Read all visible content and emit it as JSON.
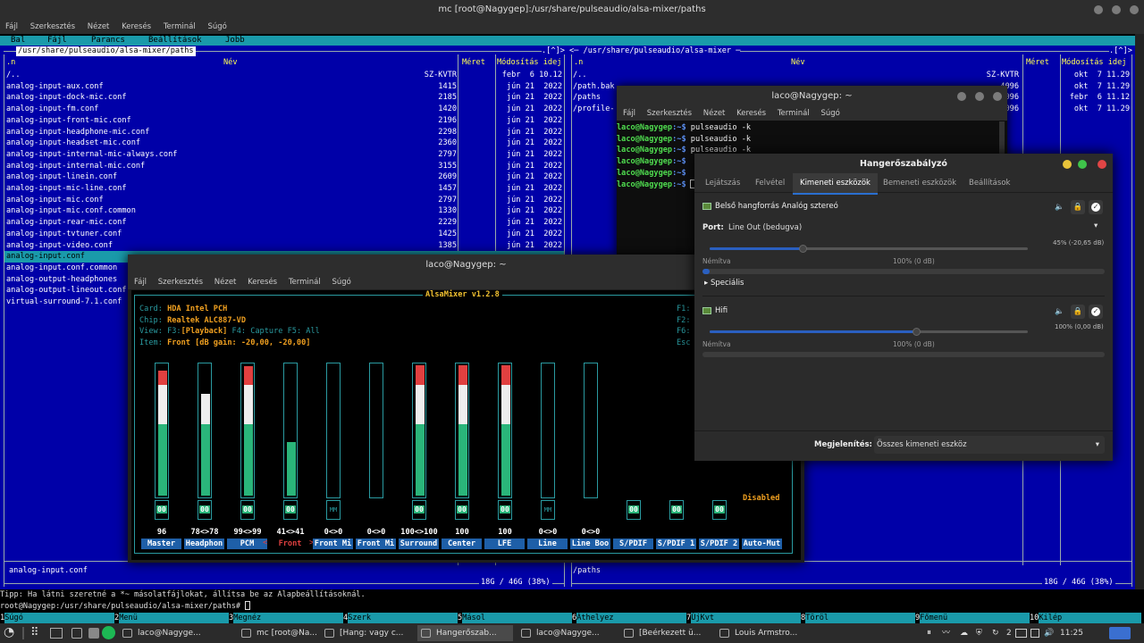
{
  "main_window": {
    "title": "mc [root@Nagygep]:/usr/share/pulseaudio/alsa-mixer/paths",
    "menu": [
      "Fájl",
      "Szerkesztés",
      "Nézet",
      "Keresés",
      "Terminál",
      "Súgó"
    ]
  },
  "mc": {
    "menubar": [
      "Bal",
      "Fájl",
      "Parancs",
      "Beállítások",
      "Jobb"
    ],
    "left_panel": {
      "path": "/usr/share/pulseaudio/alsa-mixer/paths",
      "top_marker": ".[^]>",
      "header": {
        "n": ".n",
        "name": "Név",
        "size": "Méret",
        "mtime": "Módosítás idej"
      },
      "files": [
        {
          "name": "/..",
          "size": "SZ-KVTR",
          "mtime": "febr  6 10.12"
        },
        {
          "name": "analog-input-aux.conf",
          "size": "1415",
          "mtime": "jún 21  2022"
        },
        {
          "name": "analog-input-dock-mic.conf",
          "size": "2185",
          "mtime": "jún 21  2022"
        },
        {
          "name": "analog-input-fm.conf",
          "size": "1420",
          "mtime": "jún 21  2022"
        },
        {
          "name": "analog-input-front-mic.conf",
          "size": "2196",
          "mtime": "jún 21  2022"
        },
        {
          "name": "analog-input-headphone-mic.conf",
          "size": "2298",
          "mtime": "jún 21  2022"
        },
        {
          "name": "analog-input-headset-mic.conf",
          "size": "2360",
          "mtime": "jún 21  2022"
        },
        {
          "name": "analog-input-internal-mic-always.conf",
          "size": "2797",
          "mtime": "jún 21  2022"
        },
        {
          "name": "analog-input-internal-mic.conf",
          "size": "3155",
          "mtime": "jún 21  2022"
        },
        {
          "name": "analog-input-linein.conf",
          "size": "2609",
          "mtime": "jún 21  2022"
        },
        {
          "name": "analog-input-mic-line.conf",
          "size": "1457",
          "mtime": "jún 21  2022"
        },
        {
          "name": "analog-input-mic.conf",
          "size": "2797",
          "mtime": "jún 21  2022"
        },
        {
          "name": "analog-input-mic.conf.common",
          "size": "1330",
          "mtime": "jún 21  2022"
        },
        {
          "name": "analog-input-rear-mic.conf",
          "size": "2229",
          "mtime": "jún 21  2022"
        },
        {
          "name": "analog-input-tvtuner.conf",
          "size": "1425",
          "mtime": "jún 21  2022"
        },
        {
          "name": "analog-input-video.conf",
          "size": "1385",
          "mtime": "jún 21  2022"
        },
        {
          "name": "analog-input.conf",
          "size": "",
          "mtime": ""
        },
        {
          "name": "analog-input.conf.common",
          "size": "",
          "mtime": ""
        },
        {
          "name": "analog-output-headphones",
          "size": "",
          "mtime": ""
        },
        {
          "name": "analog-output-lineout.conf",
          "size": "",
          "mtime": ""
        },
        {
          "name": "virtual-surround-7.1.conf",
          "size": "",
          "mtime": ""
        }
      ],
      "selected_index": 16,
      "status_name": "analog-input.conf",
      "disk": "18G / 46G (38%)"
    },
    "right_panel": {
      "path": "/usr/share/pulseaudio/alsa-mixer",
      "top_marker": ".[^]>",
      "header": {
        "n": ".n",
        "name": "Név",
        "size": "Méret",
        "mtime": "Módosítás idej"
      },
      "files": [
        {
          "name": "/..",
          "size": "SZ-KVTR",
          "mtime": "okt  7 11.29"
        },
        {
          "name": "/path.bak",
          "size": "4096",
          "mtime": "okt  7 11.29"
        },
        {
          "name": "/paths",
          "size": "4096",
          "mtime": "febr  6 11.12"
        },
        {
          "name": "/profile-",
          "size": "4096",
          "mtime": "okt  7 11.29"
        }
      ],
      "status_name": "/paths",
      "disk": "18G / 46G (38%)"
    },
    "tip": "Tipp: Ha látni szeretné a *~ másolatfájlokat, állítsa be az Alapbeállításoknál.",
    "prompt": "root@Nagygep:/usr/share/pulseaudio/alsa-mixer/paths#",
    "fkeys": [
      {
        "n": "1",
        "label": "Súgó"
      },
      {
        "n": "2",
        "label": "Menü"
      },
      {
        "n": "3",
        "label": "Megnéz"
      },
      {
        "n": "4",
        "label": "Szerk"
      },
      {
        "n": "5",
        "label": "Másol"
      },
      {
        "n": "6",
        "label": "Áthelyez"
      },
      {
        "n": "7",
        "label": "ÚjKvt"
      },
      {
        "n": "8",
        "label": "Töröl"
      },
      {
        "n": "9",
        "label": "Főmenü"
      },
      {
        "n": "10",
        "label": "Kilép"
      }
    ]
  },
  "alsa_window": {
    "title": "laco@Nagygep: ~",
    "menu": [
      "Fájl",
      "Szerkesztés",
      "Nézet",
      "Keresés",
      "Terminál",
      "Súgó"
    ],
    "mixer_title": "AlsaMixer v1.2.8",
    "card_label": "Card:",
    "card": "HDA Intel PCH",
    "chip_label": "Chip:",
    "chip": "Realtek ALC887-VD",
    "view_label": "View:",
    "view_f3": "F3:",
    "view_playback": "[Playback]",
    "view_rest": " F4: Capture  F5: All",
    "item_label": "Item:",
    "item": "Front [dB gain: -20,00, -20,00]",
    "right_keys": [
      "F1:",
      "F2:",
      "F6:",
      "Esc"
    ],
    "disabled": "Disabled",
    "channels": [
      {
        "name": "Master",
        "value": "96",
        "level": 96,
        "mute": "00"
      },
      {
        "name": "Headphon",
        "value": "78<>78",
        "level": 78,
        "mute": "00"
      },
      {
        "name": "PCM",
        "value": "99<>99",
        "level": 99,
        "mute": "00"
      },
      {
        "name": "Front",
        "value": "41<>41",
        "level": 41,
        "mute": "00"
      },
      {
        "name": "Front Mi",
        "value": "0<>0",
        "level": 0,
        "mute": "MM"
      },
      {
        "name": "Front Mi",
        "value": "0<>0",
        "level": 0,
        "mute": ""
      },
      {
        "name": "Surround",
        "value": "100<>100",
        "level": 100,
        "mute": "00"
      },
      {
        "name": "Center",
        "value": "100",
        "level": 100,
        "mute": "00"
      },
      {
        "name": "LFE",
        "value": "100",
        "level": 100,
        "mute": "00"
      },
      {
        "name": "Line",
        "value": "0<>0",
        "level": 0,
        "mute": "MM"
      },
      {
        "name": "Line Boo",
        "value": "0<>0",
        "level": 0,
        "mute": ""
      },
      {
        "name": "S/PDIF",
        "value": "",
        "level": null,
        "mute": "00"
      },
      {
        "name": "S/PDIF 1",
        "value": "",
        "level": null,
        "mute": "00"
      },
      {
        "name": "S/PDIF 2",
        "value": "",
        "level": null,
        "mute": "00"
      },
      {
        "name": "Auto-Mut",
        "value": "",
        "level": null,
        "mute": ""
      }
    ],
    "selected_channel": 3
  },
  "small_term": {
    "title": "laco@Nagygep: ~",
    "menu": [
      "Fájl",
      "Szerkesztés",
      "Nézet",
      "Keresés",
      "Terminál",
      "Súgó"
    ],
    "lines": [
      {
        "user": "laco@Nagygep",
        "path": ":~$",
        "cmd": " pulseaudio -k"
      },
      {
        "user": "laco@Nagygep",
        "path": ":~$",
        "cmd": " pulseaudio -k"
      },
      {
        "user": "laco@Nagygep",
        "path": ":~$",
        "cmd": " pulseaudio -k"
      },
      {
        "user": "laco@Nagygep",
        "path": ":~$",
        "cmd": ""
      },
      {
        "user": "laco@Nagygep",
        "path": ":~$",
        "cmd": ""
      },
      {
        "user": "laco@Nagygep",
        "path": ":~$",
        "cmd": ""
      }
    ]
  },
  "volume_control": {
    "title": "Hangerőszabályzó",
    "tabs": [
      "Lejátszás",
      "Felvétel",
      "Kimeneti eszközök",
      "Bemeneti eszközök",
      "Beállítások"
    ],
    "active_tab": 2,
    "device1": {
      "name": "Belső hangforrás Analóg sztereó",
      "port_label": "Port:",
      "port_value": "Line Out (bedugva)",
      "level_text": "45% (-20,65 dB)",
      "level": 0.45,
      "silent": "Némítva",
      "hundred": "100% (0 dB)",
      "advanced": "Speciális"
    },
    "device2": {
      "name": "Hifi",
      "level_text": "100% (0,00 dB)",
      "level": 1.0,
      "silent": "Némítva",
      "hundred": "100% (0 dB)"
    },
    "show_label": "Megjelenítés:",
    "show_value": "Összes kimeneti eszköz"
  },
  "taskbar": {
    "tasks": [
      "laco@Nagyge...",
      "mc [root@Na...",
      "[Hang: vagy c...",
      "Hangerőszab...",
      "laco@Nagyge...",
      "[Beérkezett ü...",
      "Louis Armstro..."
    ],
    "active_task": 3,
    "tray_num": "2",
    "clock": "11:25"
  },
  "colors": {
    "mc_blue": "#0000a8",
    "mc_cyan": "#1a9aaa",
    "alsa_green": "#2ab57a",
    "alsa_red": "#e04040",
    "alsa_orange": "#f0a020",
    "vol_blue": "#2a5fc0"
  }
}
